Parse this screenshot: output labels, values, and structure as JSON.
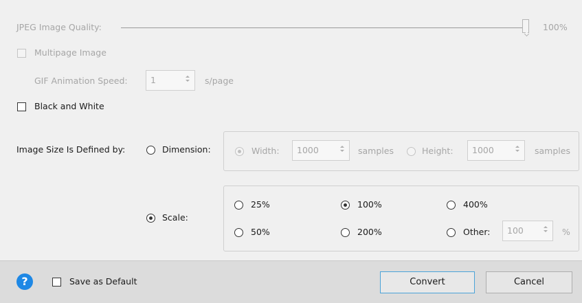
{
  "jpeg": {
    "label": "JPEG Image Quality:",
    "value_label": "100%",
    "value_fraction": 1.0
  },
  "multipage": {
    "label": "Multipage Image",
    "checked": false
  },
  "gif": {
    "label": "GIF Animation Speed:",
    "value": "1",
    "unit": "s/page"
  },
  "bw": {
    "label": "Black and White",
    "checked": false
  },
  "image_size": {
    "label": "Image Size Is Defined by:",
    "dimension_label": "Dimension:",
    "scale_label": "Scale:",
    "selected": "Scale"
  },
  "dimension": {
    "width_label": "Width:",
    "width_value": "1000",
    "width_unit": "samples",
    "height_label": "Height:",
    "height_value": "1000",
    "height_unit": "samples",
    "selected": "Width"
  },
  "scale": {
    "options": [
      "25%",
      "100%",
      "400%",
      "50%",
      "200%"
    ],
    "other_label": "Other:",
    "other_value": "100",
    "other_unit": "%",
    "selected": "100%"
  },
  "footer": {
    "help_glyph": "?",
    "save_default_label": "Save as Default",
    "convert_label": "Convert",
    "cancel_label": "Cancel"
  },
  "colors": {
    "accent": "#1e88e5",
    "primary_button_border": "#4aa3d8"
  }
}
